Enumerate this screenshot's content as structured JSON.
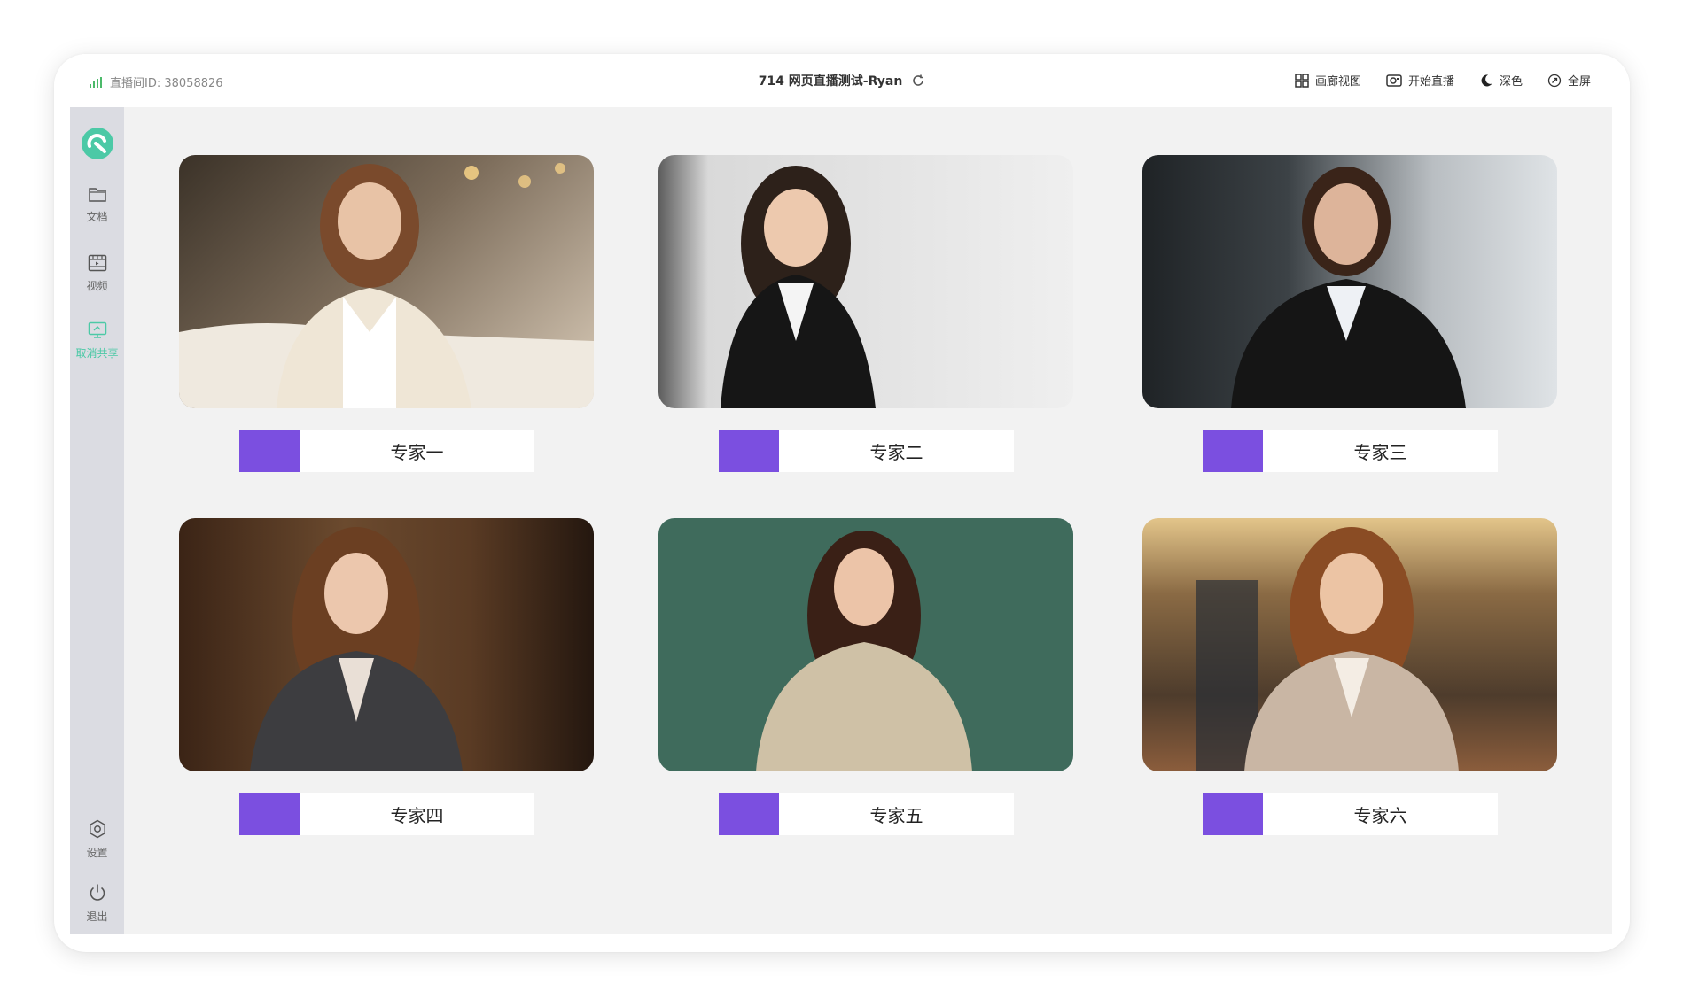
{
  "header": {
    "room_id": "直播间ID: 38058826",
    "title": "714 网页直播测试-Ryan",
    "actions": [
      {
        "label": "画廊视图",
        "icon": "grid-icon"
      },
      {
        "label": "开始直播",
        "icon": "camera-icon"
      },
      {
        "label": "深色",
        "icon": "moon-icon"
      },
      {
        "label": "全屏",
        "icon": "fullscreen-icon"
      }
    ]
  },
  "sidebar": {
    "items": [
      {
        "label": "文档",
        "icon": "folder-icon"
      },
      {
        "label": "视频",
        "icon": "film-icon"
      },
      {
        "label": "取消共享",
        "icon": "screen-share-icon"
      }
    ],
    "bottom": [
      {
        "label": "设置",
        "icon": "settings-icon"
      },
      {
        "label": "退出",
        "icon": "power-icon"
      }
    ]
  },
  "experts": [
    {
      "name": "专家一"
    },
    {
      "name": "专家二"
    },
    {
      "name": "专家三"
    },
    {
      "name": "专家四"
    },
    {
      "name": "专家五"
    },
    {
      "name": "专家六"
    }
  ],
  "colors": {
    "accent_green": "#4cc9a6",
    "nameplate_swatch": "#7b4fe0",
    "sidebar_bg": "#dbdce2",
    "content_bg": "#f2f2f2"
  }
}
